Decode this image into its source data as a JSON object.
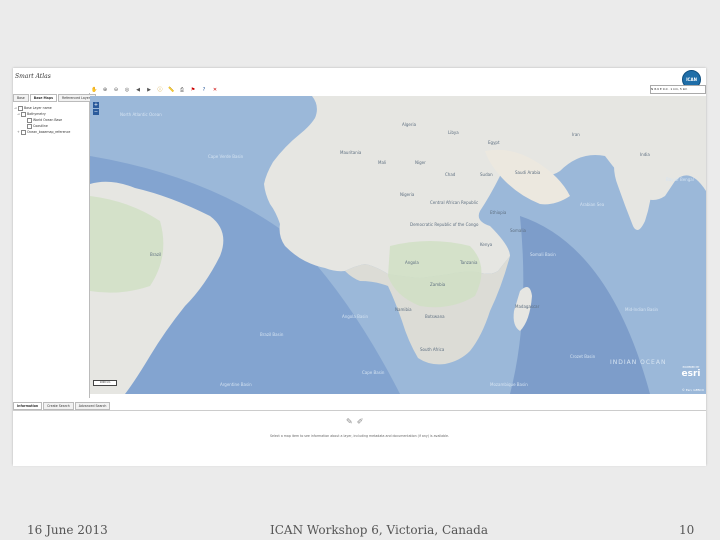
{
  "app": {
    "title": "Smart Atlas",
    "logo": "ICAN"
  },
  "left_panel": {
    "tabs": [
      {
        "label": "Base",
        "active": false
      },
      {
        "label": "Base Maps",
        "active": true
      },
      {
        "label": "Referenced Layers",
        "active": false
      }
    ],
    "tree": [
      {
        "label": "Base Layer name",
        "toggle": "⊿",
        "indent": 0
      },
      {
        "label": "Bathymetry",
        "toggle": "⊿",
        "indent": 1
      },
      {
        "label": "World Ocean Base",
        "toggle": "",
        "indent": 2
      },
      {
        "label": "Coastline",
        "toggle": "",
        "indent": 2
      },
      {
        "label": "Ocean_basemap_reference",
        "toggle": "+",
        "indent": 1
      }
    ]
  },
  "toolbar": {
    "icons": [
      "pan-icon",
      "zoom-in-icon",
      "zoom-out-icon",
      "full-extent-icon",
      "back-icon",
      "forward-icon",
      "info-icon",
      "measure-icon",
      "print-icon",
      "bookmark-icon",
      "help-icon",
      "clear-icon"
    ],
    "coordinates": "N 8.9 E 9.0 · 1 km, 5 km"
  },
  "map": {
    "colors": {
      "ocean": "#9bb8d9",
      "deep_ocean": "#5f87c0",
      "land": "#e6e6e2",
      "land_green": "#cfe0c3",
      "desert": "#ece8df"
    },
    "labels": [
      {
        "text": "North Atlantic Ocean",
        "kind": "sea"
      },
      {
        "text": "Cape Verde Basin",
        "kind": "sea"
      },
      {
        "text": "Algeria",
        "kind": "land"
      },
      {
        "text": "Libya",
        "kind": "land"
      },
      {
        "text": "Egypt",
        "kind": "land"
      },
      {
        "text": "Mauritania",
        "kind": "land"
      },
      {
        "text": "Mali",
        "kind": "land"
      },
      {
        "text": "Niger",
        "kind": "land"
      },
      {
        "text": "Chad",
        "kind": "land"
      },
      {
        "text": "Sudan",
        "kind": "land"
      },
      {
        "text": "Saudi Arabia",
        "kind": "land"
      },
      {
        "text": "Iran",
        "kind": "land"
      },
      {
        "text": "India",
        "kind": "land"
      },
      {
        "text": "Nigeria",
        "kind": "land"
      },
      {
        "text": "Central African Republic",
        "kind": "land"
      },
      {
        "text": "Ethiopia",
        "kind": "land"
      },
      {
        "text": "Somalia",
        "kind": "land"
      },
      {
        "text": "Democratic Republic of the Congo",
        "kind": "land"
      },
      {
        "text": "Kenya",
        "kind": "land"
      },
      {
        "text": "Tanzania",
        "kind": "land"
      },
      {
        "text": "Angola",
        "kind": "land"
      },
      {
        "text": "Zambia",
        "kind": "land"
      },
      {
        "text": "Namibia",
        "kind": "land"
      },
      {
        "text": "Botswana",
        "kind": "land"
      },
      {
        "text": "South Africa",
        "kind": "land"
      },
      {
        "text": "Madagascar",
        "kind": "land"
      },
      {
        "text": "Brazil",
        "kind": "land"
      },
      {
        "text": "Bay of Bengal",
        "kind": "sea"
      },
      {
        "text": "Arabian Sea",
        "kind": "sea"
      },
      {
        "text": "Somali Basin",
        "kind": "sea"
      },
      {
        "text": "Angola Basin",
        "kind": "sea"
      },
      {
        "text": "Brazil Basin",
        "kind": "sea"
      },
      {
        "text": "Cape Basin",
        "kind": "sea"
      },
      {
        "text": "Argentine Basin",
        "kind": "sea"
      },
      {
        "text": "Mozambique Basin",
        "kind": "sea"
      },
      {
        "text": "Crozet Basin",
        "kind": "sea"
      },
      {
        "text": "Mid-Indian Basin",
        "kind": "sea"
      },
      {
        "text": "INDIAN OCEAN",
        "kind": "sea"
      }
    ],
    "zoom_in": "+",
    "zoom_out": "−",
    "scale": "1000 km",
    "esri_powered": "POWERED BY",
    "esri": "esri",
    "credit": "© Esri, GEBCO"
  },
  "bottom_panel": {
    "tabs": [
      {
        "label": "Information",
        "active": true
      },
      {
        "label": "Create Search",
        "active": false
      },
      {
        "label": "Advanced Search",
        "active": false
      }
    ],
    "message": "Select a map item to see information about a layer, including metadata and documentation (if any) is available.",
    "icons": [
      "feature-info-icon",
      "layer-info-icon"
    ]
  },
  "footer": {
    "date": "16 June 2013",
    "event": "ICAN Workshop 6, Victoria, Canada",
    "page": "10"
  }
}
